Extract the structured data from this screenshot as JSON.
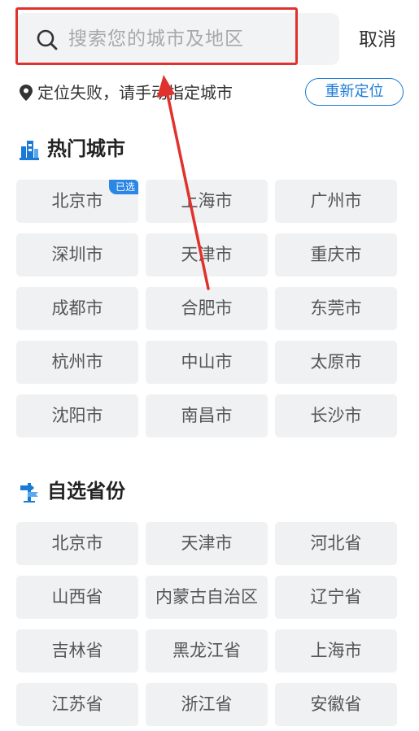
{
  "search": {
    "placeholder": "搜索您的城市及地区",
    "cancel_label": "取消"
  },
  "location": {
    "status_text": "定位失败，请手动指定城市",
    "relocate_label": "重新定位"
  },
  "hot_cities": {
    "title": "热门城市",
    "selected_badge": "已选",
    "items": [
      {
        "label": "北京市",
        "selected": true
      },
      {
        "label": "上海市"
      },
      {
        "label": "广州市"
      },
      {
        "label": "深圳市"
      },
      {
        "label": "天津市"
      },
      {
        "label": "重庆市"
      },
      {
        "label": "成都市"
      },
      {
        "label": "合肥市"
      },
      {
        "label": "东莞市"
      },
      {
        "label": "杭州市"
      },
      {
        "label": "中山市"
      },
      {
        "label": "太原市"
      },
      {
        "label": "沈阳市"
      },
      {
        "label": "南昌市"
      },
      {
        "label": "长沙市"
      }
    ]
  },
  "provinces": {
    "title": "自选省份",
    "items": [
      {
        "label": "北京市"
      },
      {
        "label": "天津市"
      },
      {
        "label": "河北省"
      },
      {
        "label": "山西省"
      },
      {
        "label": "内蒙古自治区"
      },
      {
        "label": "辽宁省"
      },
      {
        "label": "吉林省"
      },
      {
        "label": "黑龙江省"
      },
      {
        "label": "上海市"
      },
      {
        "label": "江苏省"
      },
      {
        "label": "浙江省"
      },
      {
        "label": "安徽省"
      }
    ]
  },
  "colors": {
    "accent": "#1a7bd6",
    "annotation": "#e0322d"
  },
  "icons": {
    "search": "search-icon",
    "location": "map-pin-icon",
    "hot_section": "building-icon",
    "province_section": "signpost-icon"
  }
}
